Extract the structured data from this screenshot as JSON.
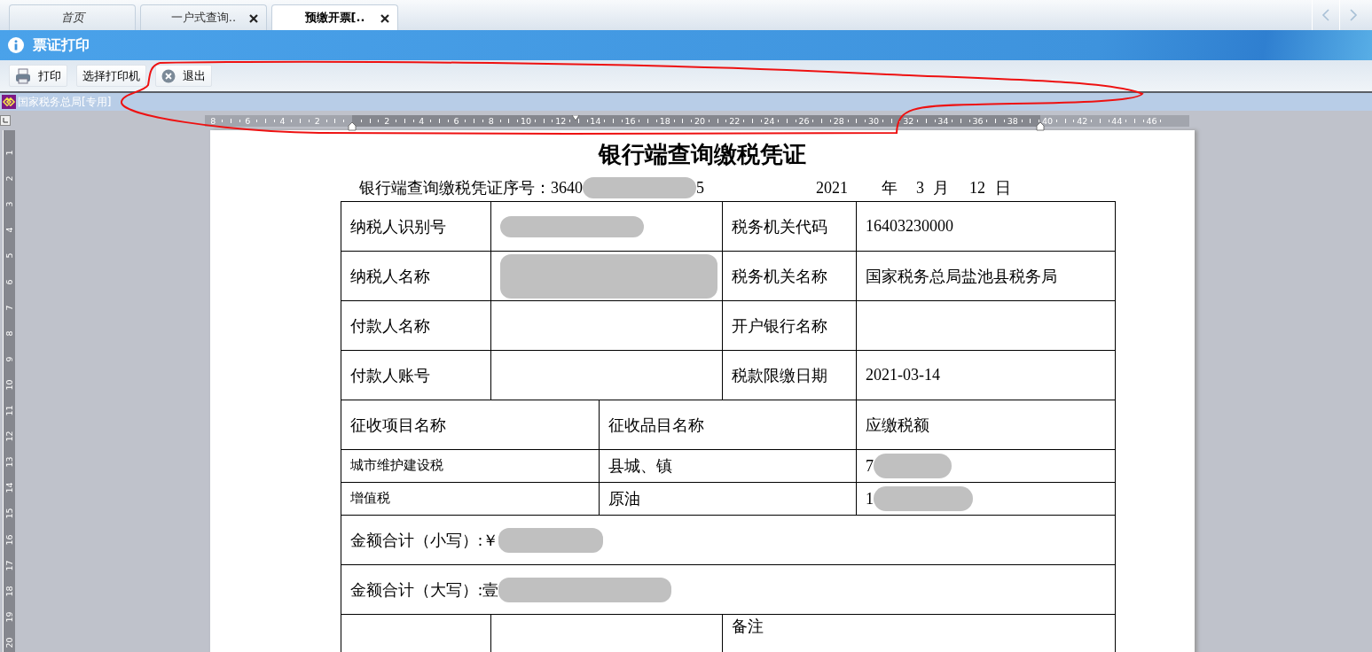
{
  "tabs": [
    {
      "label": "首页",
      "selected": false,
      "closable": false
    },
    {
      "label": "一户式查询..",
      "selected": false,
      "closable": true
    },
    {
      "label": "预缴开票[..",
      "selected": true,
      "closable": true
    }
  ],
  "panel": {
    "title": "票证打印"
  },
  "toolbar": [
    {
      "kind": "printer",
      "label": "打印"
    },
    {
      "kind": "plain",
      "label": "选择打印机"
    },
    {
      "kind": "exit",
      "label": "退出"
    }
  ],
  "plugin_bar": {
    "label": "国家税务总局[专用]"
  },
  "ruler": {
    "left_labels": [
      "8",
      "6",
      "4",
      "2"
    ],
    "right_labels": [
      "2",
      "4",
      "6",
      "8",
      "10",
      "12",
      "14",
      "16",
      "18",
      "20",
      "22",
      "24",
      "26",
      "28",
      "30",
      "32",
      "34",
      "36",
      "38",
      "40",
      "42",
      "44",
      "46"
    ],
    "vertical_labels": [
      "1",
      "2",
      "3",
      "4",
      "5",
      "6",
      "7",
      "8",
      "9",
      "10",
      "11",
      "12",
      "13",
      "14",
      "15",
      "16",
      "17",
      "18",
      "19",
      "20"
    ]
  },
  "document": {
    "title": "银行端查询缴税凭证",
    "serial": {
      "label": "银行端查询缴税凭证序号：",
      "start": "3640",
      "redacted": true,
      "end": "5"
    },
    "date": {
      "year": "2021",
      "year_unit": "年",
      "month": "3",
      "month_unit": "月",
      "day": "12",
      "day_unit": "日"
    },
    "info_rows": [
      {
        "label": "纳税人识别号",
        "value_redacted": true,
        "label_2": "税务机关代码",
        "value_2": "16403230000"
      },
      {
        "label": "纳税人名称",
        "value_redacted": true,
        "label_2": "税务机关名称",
        "value_2": "国家税务总局盐池县税务局"
      },
      {
        "label": "付款人名称",
        "value_redacted": false,
        "label_2": "开户银行名称"
      },
      {
        "label": "付款人账号",
        "value_redacted": false,
        "label_2": "税款限缴日期",
        "value_2": "2021-03-14"
      }
    ],
    "items_header": [
      "征收项目名称",
      "征收品目名称",
      "应缴税额"
    ],
    "items": [
      {
        "project": "城市维护建设税",
        "item": "县城、镇",
        "amount": "7",
        "amount_redacted": true
      },
      {
        "project": "增值税",
        "item": "原油",
        "amount": "1",
        "amount_redacted": true
      }
    ],
    "totals": [
      {
        "label": "金额合计（小写）:￥",
        "redacted": true
      },
      {
        "label": "金额合计（大写）:壹",
        "redacted": true
      }
    ],
    "last_row": {
      "column_3": "备注"
    }
  }
}
